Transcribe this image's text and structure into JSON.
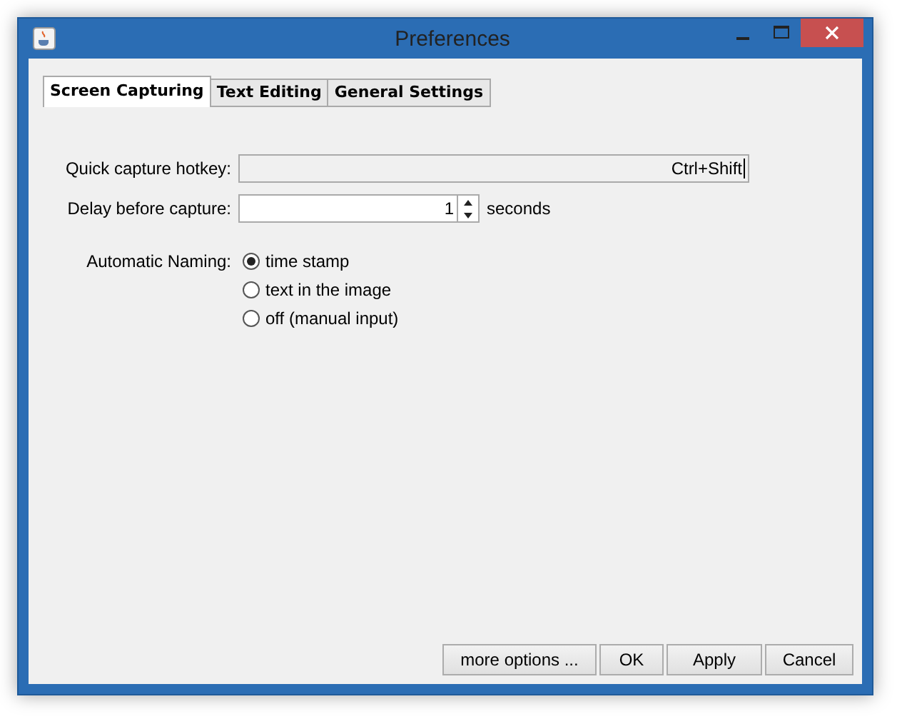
{
  "window": {
    "title": "Preferences"
  },
  "tabs": [
    {
      "label": "Screen Capturing",
      "selected": true
    },
    {
      "label": "Text Editing",
      "selected": false
    },
    {
      "label": "General Settings",
      "selected": false
    }
  ],
  "hotkey": {
    "label": "Quick capture hotkey:",
    "value": "Ctrl+Shift"
  },
  "delay": {
    "label": "Delay before capture:",
    "value": "1",
    "unit": "seconds"
  },
  "naming": {
    "label": "Automatic Naming:",
    "options": [
      {
        "label": "time stamp",
        "selected": true
      },
      {
        "label": "text in the image",
        "selected": false
      },
      {
        "label": "off (manual input)",
        "selected": false
      }
    ]
  },
  "buttons": [
    "more options ...",
    "OK",
    "Apply",
    "Cancel"
  ]
}
